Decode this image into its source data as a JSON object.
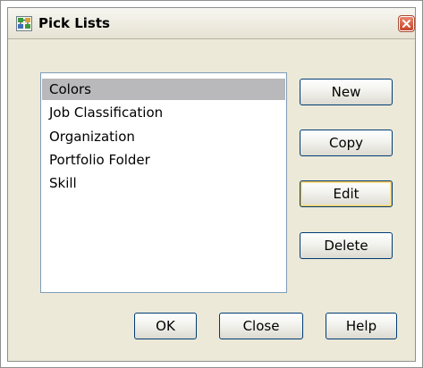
{
  "window": {
    "title": "Pick Lists"
  },
  "list": {
    "items": [
      {
        "label": "Colors",
        "selected": true
      },
      {
        "label": "Job Classification",
        "selected": false
      },
      {
        "label": "Organization",
        "selected": false
      },
      {
        "label": "Portfolio Folder",
        "selected": false
      },
      {
        "label": "Skill",
        "selected": false
      }
    ]
  },
  "side_buttons": {
    "new_label": "New",
    "copy_label": "Copy",
    "edit_label": "Edit",
    "delete_label": "Delete",
    "focused": "Edit"
  },
  "footer_buttons": {
    "ok_label": "OK",
    "close_label": "Close",
    "help_label": "Help"
  },
  "icons": {
    "title": "pick-list-icon",
    "close": "close-icon"
  },
  "colors": {
    "dialog_background": "#ece9d8",
    "selection": "#b9b9bb",
    "close_button": "#c5452a",
    "focus_ring": "#f7c84e",
    "button_border": "#003c74"
  }
}
